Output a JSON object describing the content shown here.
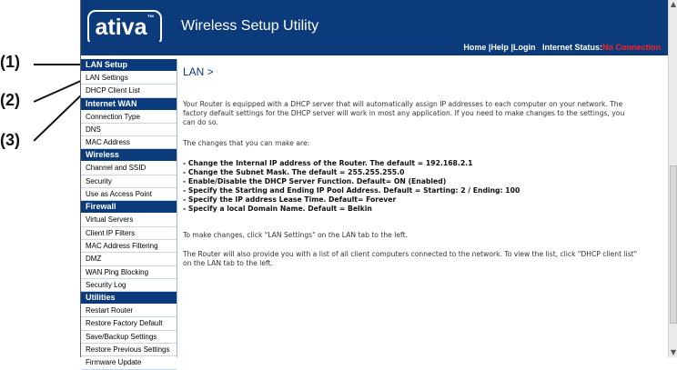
{
  "callouts": [
    "(1)",
    "(2)",
    "(3)"
  ],
  "header": {
    "logo_text": "ativa",
    "logo_tm": "™",
    "title": "Wireless Setup Utility",
    "links": [
      "Home",
      "Help",
      "Login"
    ],
    "separator": "|",
    "status_label": "Internet Status:",
    "status_value": "No Connection"
  },
  "sidebar": {
    "sections": [
      {
        "title": "LAN Setup",
        "items": [
          "LAN Settings",
          "DHCP Client List"
        ]
      },
      {
        "title": "Internet WAN",
        "items": [
          "Connection Type",
          "DNS",
          "MAC Address"
        ]
      },
      {
        "title": "Wireless",
        "items": [
          "Channel and SSID",
          "Security",
          "Use as Access Point"
        ]
      },
      {
        "title": "Firewall",
        "items": [
          "Virtual Servers",
          "Client IP Filters",
          "MAC Address Filtering",
          "DMZ",
          "WAN Ping Blocking",
          "Security Log"
        ]
      },
      {
        "title": "Utilities",
        "items": [
          "Restart Router",
          "Restore Factory Default",
          "Save/Backup Settings",
          "Restore Previous Settings",
          "Firmware Update"
        ]
      }
    ]
  },
  "main": {
    "heading": "LAN >",
    "intro": "Your Router is equipped with a DHCP server that will automatically assign IP addresses to each computer on your network. The factory default settings for the DHCP server will work in most any application. If you need to make changes to the settings, you can do so.",
    "changes_intro": "The changes that you can make are:",
    "changes": [
      "- Change the Internal IP address of the Router. The default = 192.168.2.1",
      "- Change the Subnet Mask. The default = 255.255.255.0",
      "- Enable/Disable the DHCP Server Function. Default= ON (Enabled)",
      "- Specify the Starting and Ending IP Pool Address. Default = Starting: 2 / Ending: 100",
      "- Specify the IP address Lease Time. Default= Forever",
      "- Specify a local Domain Name. Default = Belkin"
    ],
    "to_make_changes": "To make changes, click \"LAN Settings\" on the LAN tab to the left.",
    "client_list_note": "The Router will also provide you with a list of all client computers connected to the network. To view the list, click \"DHCP client list\" on the LAN tab to the left."
  },
  "colors": {
    "brand_blue": "#0c3b7c",
    "status_red": "#ff2020"
  }
}
